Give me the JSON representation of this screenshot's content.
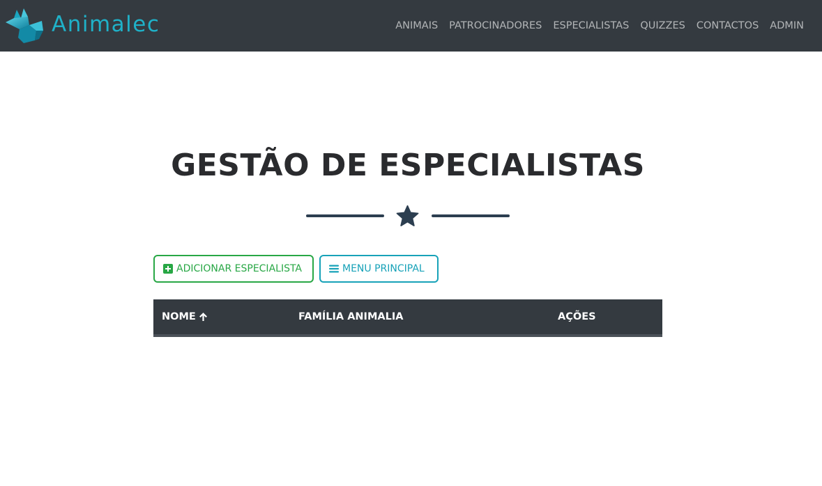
{
  "brand": {
    "name": "Animalec"
  },
  "nav": {
    "items": [
      {
        "label": "ANIMAIS"
      },
      {
        "label": "PATROCINADORES"
      },
      {
        "label": "ESPECIALISTAS"
      },
      {
        "label": "QUIZZES"
      },
      {
        "label": "CONTACTOS"
      },
      {
        "label": "ADMIN"
      }
    ]
  },
  "page": {
    "title": "GESTÃO DE ESPECIALISTAS",
    "divider_icon": "star-icon"
  },
  "actions": {
    "add_label": "ADICIONAR ESPECIALISTA",
    "add_icon": "plus-square-icon",
    "menu_label": "MENU PRINCIPAL",
    "menu_icon": "bars-icon"
  },
  "table": {
    "columns": [
      {
        "label": "NOME",
        "sort_icon": "arrow-up-icon"
      },
      {
        "label": "FAMÍLIA ANIMALIA"
      },
      {
        "label": "AÇÕES"
      }
    ],
    "rows": []
  },
  "colors": {
    "navbar_bg": "#343a40",
    "brand": "#1fb1c8",
    "success": "#28a745",
    "info": "#17a2b8",
    "divider": "#2c3e50",
    "title": "#2a2b2e"
  }
}
